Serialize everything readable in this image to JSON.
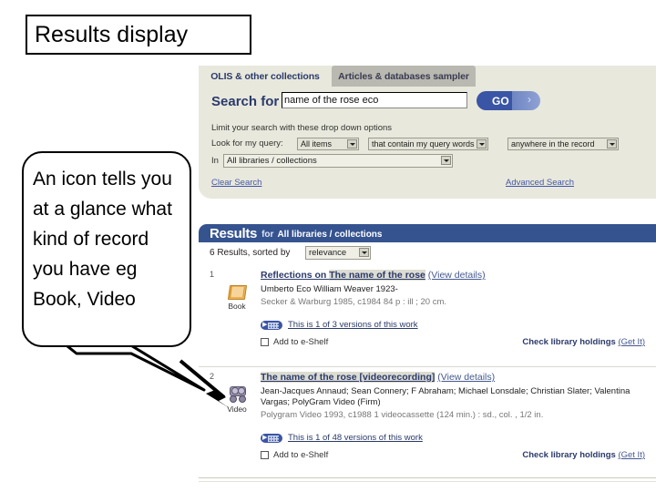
{
  "slide": {
    "title": "Results display",
    "callout_text": "An icon tells you at a glance what kind of record you have eg Book, Video"
  },
  "search_panel": {
    "tabs": [
      {
        "label": "OLIS & other collections",
        "active": true
      },
      {
        "label": "Articles & databases sampler",
        "active": false
      }
    ],
    "search_for_label": "Search for",
    "search_value": "name of the rose eco",
    "search_placeholder": "",
    "go_label": "GO",
    "go_arrow": "›",
    "limit_note": "Limit your search with these drop down options",
    "look_for_label": "Look for my query:",
    "dropdown_items": "All items",
    "dropdown_contain": "that contain my query words",
    "dropdown_where": "anywhere in the record",
    "in_label": "In",
    "dropdown_libraries": "All libraries / collections",
    "clear_search": "Clear Search",
    "advanced_search": "Advanced Search"
  },
  "results": {
    "header_title": "Results",
    "header_for": "for",
    "header_scope": "All libraries / collections",
    "count_label": "6 Results, sorted by",
    "sort_value": "relevance",
    "items": [
      {
        "number": "1",
        "icon": "book-icon",
        "icon_label": "Book",
        "title_pre": "Reflections on ",
        "title_hl": "The name of the rose",
        "view_details": "(View details)",
        "authors": "Umberto Eco William Weaver 1923-",
        "author_hl": "Eco",
        "publication": "Secker & Warburg 1985, c1984 84 p : ill ; 20 cm.",
        "versions_text": "This is 1 of 3 versions of this work",
        "shelf_label": "Add to e-Shelf",
        "holdings_label": "Check library holdings",
        "holdings_getit": "(Get It)"
      },
      {
        "number": "2",
        "icon": "video-icon",
        "icon_label": "Video",
        "title_pre": "",
        "title_hl": "The name of the rose [videorecording]",
        "view_details": "(View details)",
        "authors": "Jean-Jacques Annaud; Sean Connery; F Abraham; Michael Lonsdale; Christian Slater; Valentina Vargas; PolyGram Video (Firm)",
        "author_hl": "",
        "publication": "Polygram Video 1993, c1988 1 videocassette (124 min.) : sd., col. , 1/2 in.",
        "versions_text": "This is 1 of 48 versions of this work",
        "shelf_label": "Add to e-Shelf",
        "holdings_label": "Check library holdings",
        "holdings_getit": "(Get It)"
      }
    ]
  },
  "colors": {
    "panel_bg": "#e8e8dc",
    "results_bar": "#35538f",
    "link": "#4458a8",
    "brand_navy": "#2b3a6b",
    "go_blue": "#3a55a5",
    "book_orange": "#f0b050",
    "video_grey": "#9b93ad"
  }
}
